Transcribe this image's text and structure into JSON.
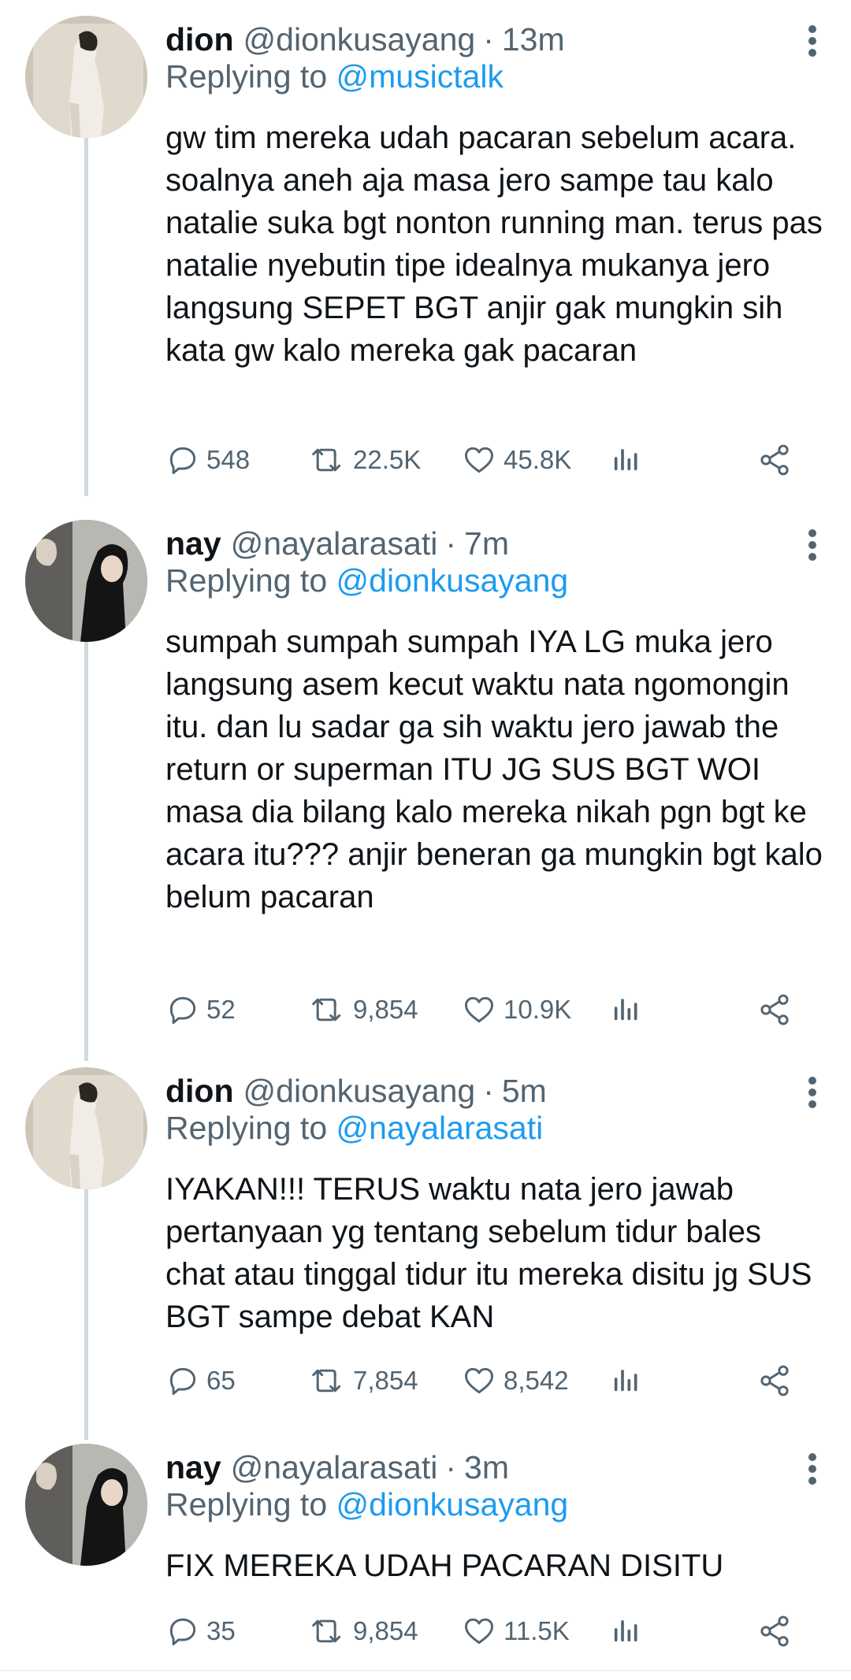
{
  "thread": [
    {
      "name": "dion",
      "handle": "@dionkusayang",
      "time": "13m",
      "replying_prefix": "Replying to",
      "replying_to": "@musictalk",
      "text": "gw tim mereka udah pacaran sebelum acara. soalnya aneh aja masa jero sampe tau kalo natalie suka bgt nonton running man. terus pas natalie nyebutin tipe idealnya mukanya jero langsung SEPET BGT anjir gak mungkin sih kata gw kalo mereka gak pacaran",
      "replies": "548",
      "retweets": "22.5K",
      "likes": "45.8K",
      "avatar": "dion"
    },
    {
      "name": "nay",
      "handle": "@nayalarasati",
      "time": "7m",
      "replying_prefix": "Replying to",
      "replying_to": "@dionkusayang",
      "text": "sumpah sumpah sumpah IYA LG muka jero langsung asem kecut waktu nata ngomongin itu. dan lu sadar ga sih waktu jero jawab the return or superman ITU JG SUS BGT WOI masa dia bilang kalo mereka nikah pgn bgt ke acara itu??? anjir beneran ga mungkin bgt kalo belum pacaran",
      "replies": "52",
      "retweets": "9,854",
      "likes": "10.9K",
      "avatar": "nay"
    },
    {
      "name": "dion",
      "handle": "@dionkusayang",
      "time": "5m",
      "replying_prefix": "Replying to",
      "replying_to": "@nayalarasati",
      "text": "IYAKAN!!! TERUS waktu nata jero jawab pertanyaan yg tentang sebelum tidur bales chat atau tinggal tidur itu mereka disitu jg SUS BGT sampe debat KAN",
      "replies": "65",
      "retweets": "7,854",
      "likes": "8,542",
      "avatar": "dion"
    },
    {
      "name": "nay",
      "handle": "@nayalarasati",
      "time": "3m",
      "replying_prefix": "Replying to",
      "replying_to": "@dionkusayang",
      "text": "FIX MEREKA UDAH PACARAN DISITU",
      "replies": "35",
      "retweets": "9,854",
      "likes": "11.5K",
      "avatar": "nay"
    }
  ],
  "separator": "·",
  "icons": {
    "reply": "reply-icon",
    "retweet": "retweet-icon",
    "like": "heart-icon",
    "views": "analytics-icon",
    "share": "share-icon",
    "more": "more-vertical-icon"
  },
  "colors": {
    "link": "#1d9bf0",
    "secondary_text": "#536471",
    "thread_line": "#cfd9de"
  }
}
